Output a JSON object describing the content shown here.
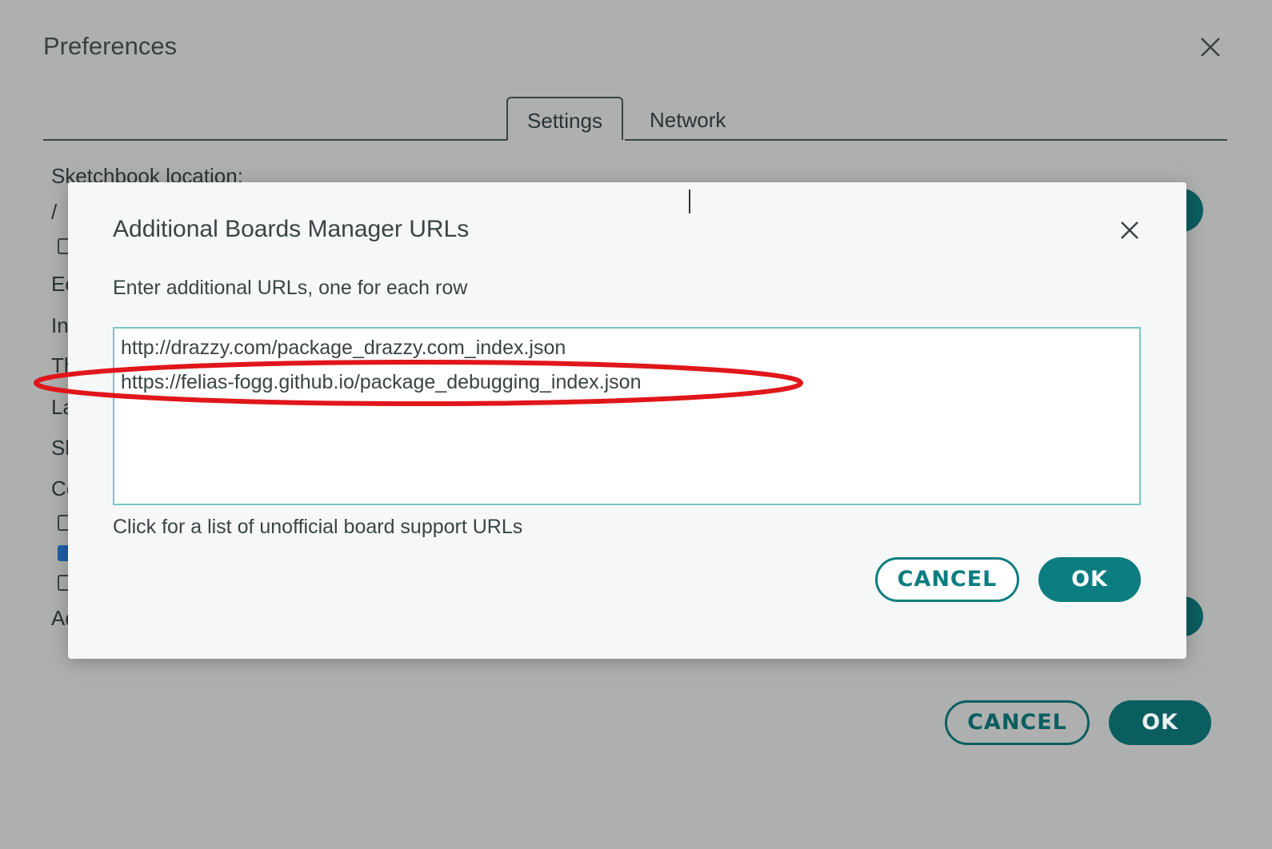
{
  "preferences": {
    "title": "Preferences",
    "tabs": [
      {
        "label": "Settings",
        "active": true
      },
      {
        "label": "Network",
        "active": false
      }
    ],
    "sketchbook_label": "Sketchbook location:",
    "partial_labels": [
      "/ ",
      "Ec",
      "In",
      "Th",
      "La",
      "Sh",
      "Co",
      "Ad"
    ],
    "checkboxes": [
      false,
      false,
      true,
      false
    ],
    "cancel_label": "CANCEL",
    "ok_label": "OK"
  },
  "dialog": {
    "title": "Additional Boards Manager URLs",
    "instructions": "Enter additional URLs, one for each row",
    "urls": [
      "http://drazzy.com/package_drazzy.com_index.json",
      "https://felias-fogg.github.io/package_debugging_index.json"
    ],
    "link_text": "Click for a list of unofficial board support URLs",
    "cancel_label": "CANCEL",
    "ok_label": "OK"
  },
  "colors": {
    "accent": "#0b7d80",
    "accent_dark": "#0b5e60",
    "annotation": "#e0161b",
    "overlay": "#aeb0af"
  },
  "icons": {
    "close": "close-icon"
  }
}
